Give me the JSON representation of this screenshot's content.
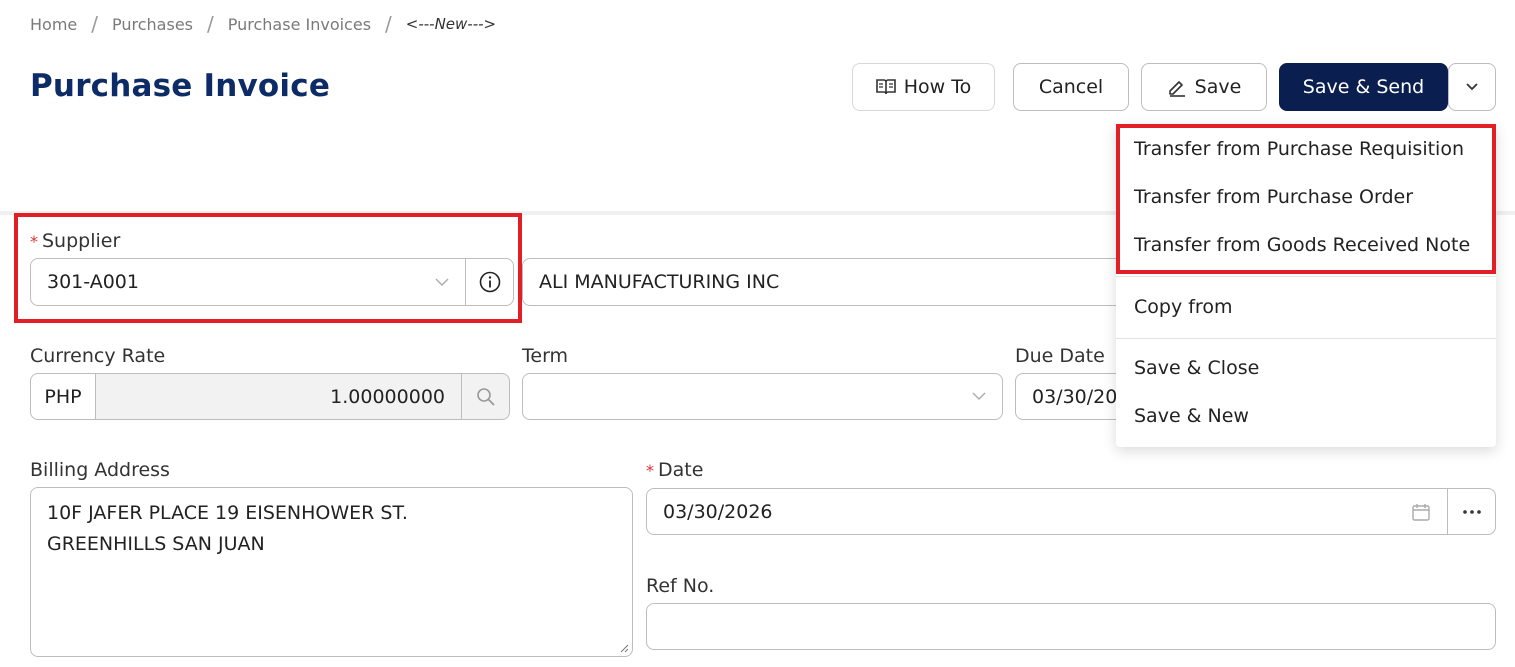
{
  "breadcrumb": {
    "home": "Home",
    "purchases": "Purchases",
    "invoices": "Purchase Invoices",
    "current": "<---New--->",
    "separator": "/"
  },
  "page": {
    "title": "Purchase Invoice"
  },
  "toolbar": {
    "howto_label": "How To",
    "cancel_label": "Cancel",
    "save_label": "Save",
    "send_label": "Save & Send"
  },
  "supplier": {
    "label": "Supplier",
    "required_mark": "*",
    "code": "301-A001",
    "name": "ALI MANUFACTURING INC"
  },
  "currency": {
    "label": "Currency Rate",
    "code": "PHP",
    "rate": "1.00000000"
  },
  "term": {
    "label": "Term",
    "value": ""
  },
  "due_date": {
    "label": "Due Date",
    "value": "03/30/20"
  },
  "billing": {
    "label": "Billing Address",
    "line1": "10F JAFER PLACE 19 EISENHOWER ST.",
    "line2": "GREENHILLS SAN JUAN"
  },
  "date": {
    "label": "Date",
    "required_mark": "*",
    "value": "03/30/2026"
  },
  "ref_no": {
    "label": "Ref No.",
    "value": ""
  },
  "menu": {
    "items": [
      "Transfer from Purchase Requisition",
      "Transfer from Purchase Order",
      "Transfer from Goods Received Note",
      "Copy from",
      "Save & Close",
      "Save & New"
    ]
  },
  "colors": {
    "title": "#0d2b66",
    "primary_button": "#0a1f4f",
    "highlight": "#e21f26",
    "required": "#e03030"
  },
  "icons": {
    "howto": "book-icon",
    "save": "pencil-icon",
    "more": "chevron-down-icon",
    "info": "info-icon",
    "search": "search-icon",
    "calendar": "calendar-icon",
    "ellipsis": "ellipsis-icon"
  }
}
